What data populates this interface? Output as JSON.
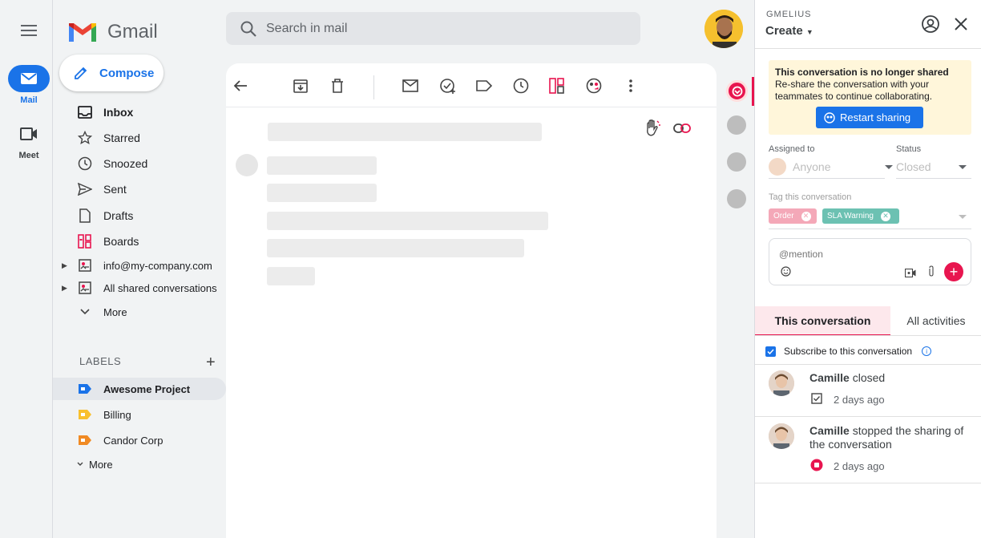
{
  "rail": {
    "items": [
      {
        "label": "Mail",
        "icon": "mail-icon"
      },
      {
        "label": "Meet",
        "icon": "video-icon"
      }
    ]
  },
  "logo": {
    "text": "Gmail"
  },
  "compose": {
    "label": "Compose"
  },
  "search": {
    "placeholder": "Search in mail"
  },
  "nav": {
    "items": [
      {
        "label": "Inbox",
        "icon": "inbox-icon"
      },
      {
        "label": "Starred",
        "icon": "star-icon"
      },
      {
        "label": "Snoozed",
        "icon": "clock-icon"
      },
      {
        "label": "Sent",
        "icon": "send-icon"
      },
      {
        "label": "Drafts",
        "icon": "file-icon"
      },
      {
        "label": "Boards",
        "icon": "boards-icon"
      },
      {
        "label": "info@my-company.com",
        "icon": "shared-inbox-icon"
      },
      {
        "label": "All shared conversations",
        "icon": "shared-inbox-icon"
      },
      {
        "label": "More",
        "icon": "chevron-down-icon"
      }
    ],
    "labels_heading": "LABELS",
    "labels": [
      {
        "label": "Awesome Project",
        "color": "#1a73e8"
      },
      {
        "label": "Billing",
        "color": "#f9c02d"
      },
      {
        "label": "Candor Corp",
        "color": "#f08a24"
      }
    ],
    "labels_more": "More"
  },
  "gmelius": {
    "brand": "GMELIUS",
    "create_label": "Create",
    "notice": {
      "title": "This conversation is no longer shared",
      "body": "Re-share the conversation with your teammates to continue collaborating.",
      "button": "Restart sharing"
    },
    "assigned_label": "Assigned to",
    "assigned_value": "Anyone",
    "status_label": "Status",
    "status_value": "Closed",
    "tag_label": "Tag this conversation",
    "tags": [
      {
        "label": "Order",
        "color": "#f4a8b8"
      },
      {
        "label": "SLA Warning",
        "color": "#6cc1b2"
      }
    ],
    "mention_placeholder": "@mention",
    "tabs": [
      {
        "label": "This conversation"
      },
      {
        "label": "All activities"
      }
    ],
    "subscribe_label": "Subscribe to this conversation",
    "activities": [
      {
        "name": "Camille",
        "text": " closed",
        "time": "2 days ago"
      },
      {
        "name": "Camille",
        "text": " stopped the sharing of the conversation",
        "time": "2 days ago"
      }
    ]
  },
  "colors": {
    "accent": "#e8154f",
    "primary": "#1a73e8",
    "notice_bg": "#fff6da"
  }
}
